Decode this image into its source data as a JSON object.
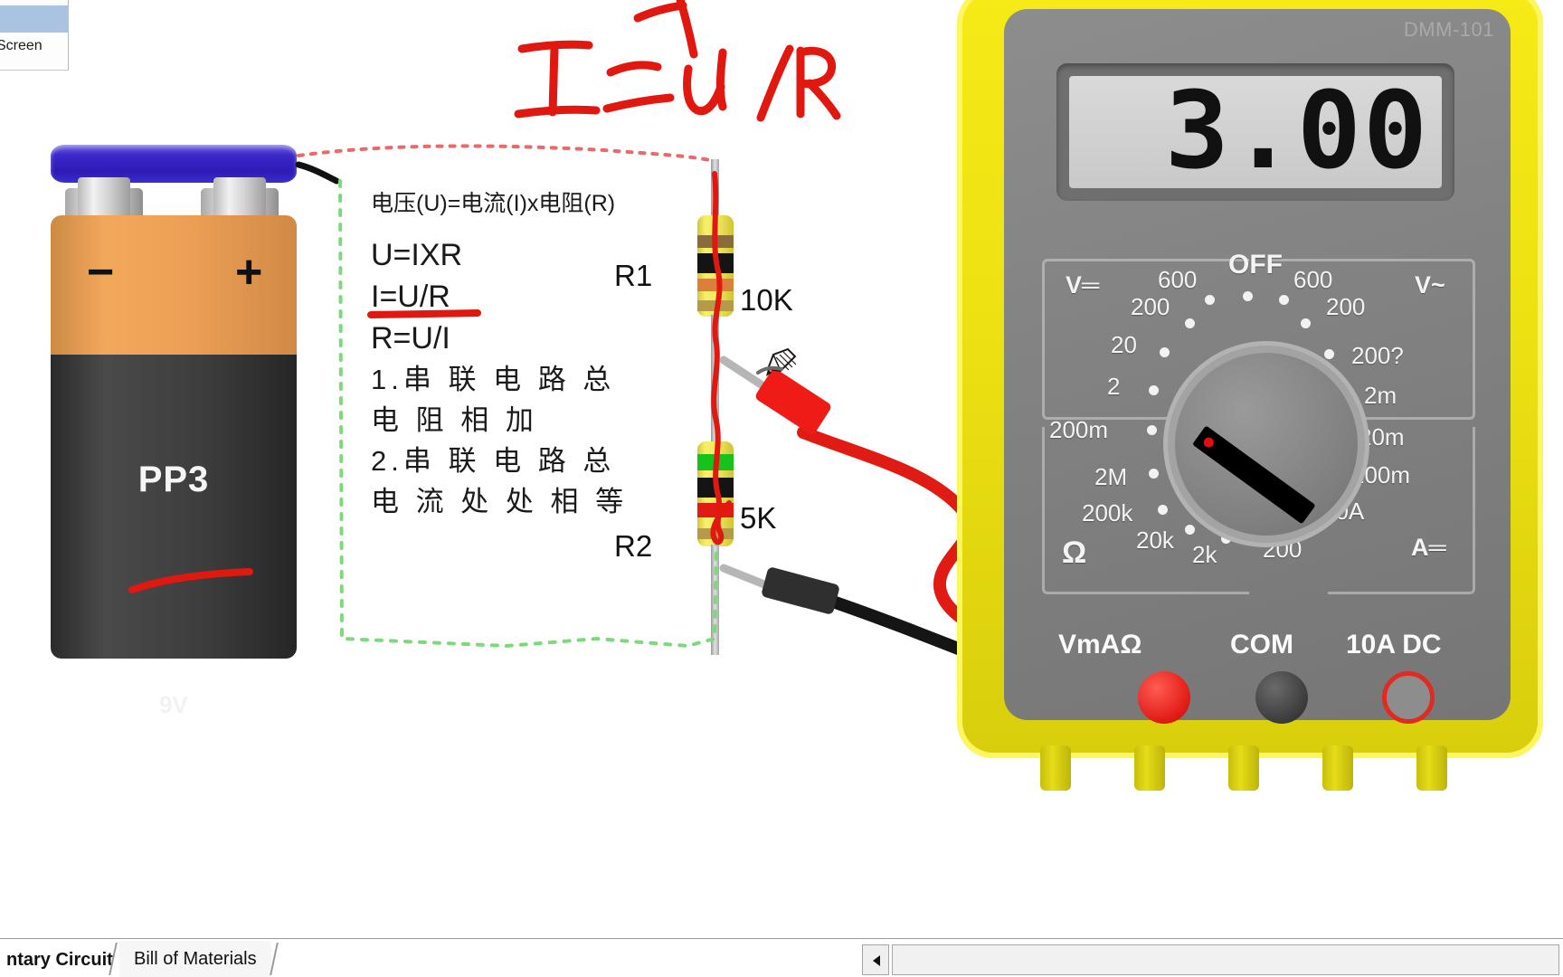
{
  "window": {
    "corner_label": "Screen"
  },
  "annotation": {
    "handwriting_text": "I=U/R",
    "ink_color": "#e1180f"
  },
  "battery": {
    "name": "PP3",
    "voltage": "9V",
    "minus": "−",
    "plus": "+",
    "cap_color": "#2e1bb5",
    "body_color": "#3d3d3d",
    "top_color": "#eda055"
  },
  "formulas": {
    "line_cn": "电压(U)=电流(I)x电阻(R)",
    "u_eq": "U=IXR",
    "i_eq": "I=U/R",
    "r_eq": "R=U/I",
    "rule1": "1.串 联 电 路 总",
    "rule1b": "电 阻 相 加",
    "rule2": "2.串 联 电 路 总",
    "rule2b": "电 流 处 处 相 等"
  },
  "components": [
    {
      "ref": "R1",
      "value": "10K",
      "bands": [
        "#8a6b3a",
        "#141414",
        "#d9803a",
        "#b59a4a"
      ]
    },
    {
      "ref": "R2",
      "value": "5K",
      "bands": [
        "#16c21c",
        "#141414",
        "#e01b14",
        "#b59a4a"
      ]
    }
  ],
  "multimeter": {
    "model": "DMM-101",
    "display_value": "3.00",
    "body_color": "#ece112",
    "selected_range": "2 (V═ DC volts)",
    "off_label": "OFF",
    "groups": {
      "vdc": "V═",
      "vac": "V~",
      "ohm": "Ω",
      "adc": "A═"
    },
    "ranges_vdc": [
      "600",
      "200",
      "20",
      "2",
      "200m"
    ],
    "ranges_vac": [
      "600",
      "200"
    ],
    "ranges_ohm": [
      "2M",
      "200k",
      "20k",
      "2k",
      "200"
    ],
    "ranges_adc": [
      "200?",
      "2m",
      "20m",
      "200m",
      "10A"
    ],
    "jacks": [
      {
        "label": "VmAΩ",
        "type": "red"
      },
      {
        "label": "COM",
        "type": "black"
      },
      {
        "label": "10A DC",
        "type": "ring"
      }
    ]
  },
  "tabs": [
    {
      "label": "ntary Circuit",
      "active": true
    },
    {
      "label": "Bill of Materials",
      "active": false
    }
  ]
}
